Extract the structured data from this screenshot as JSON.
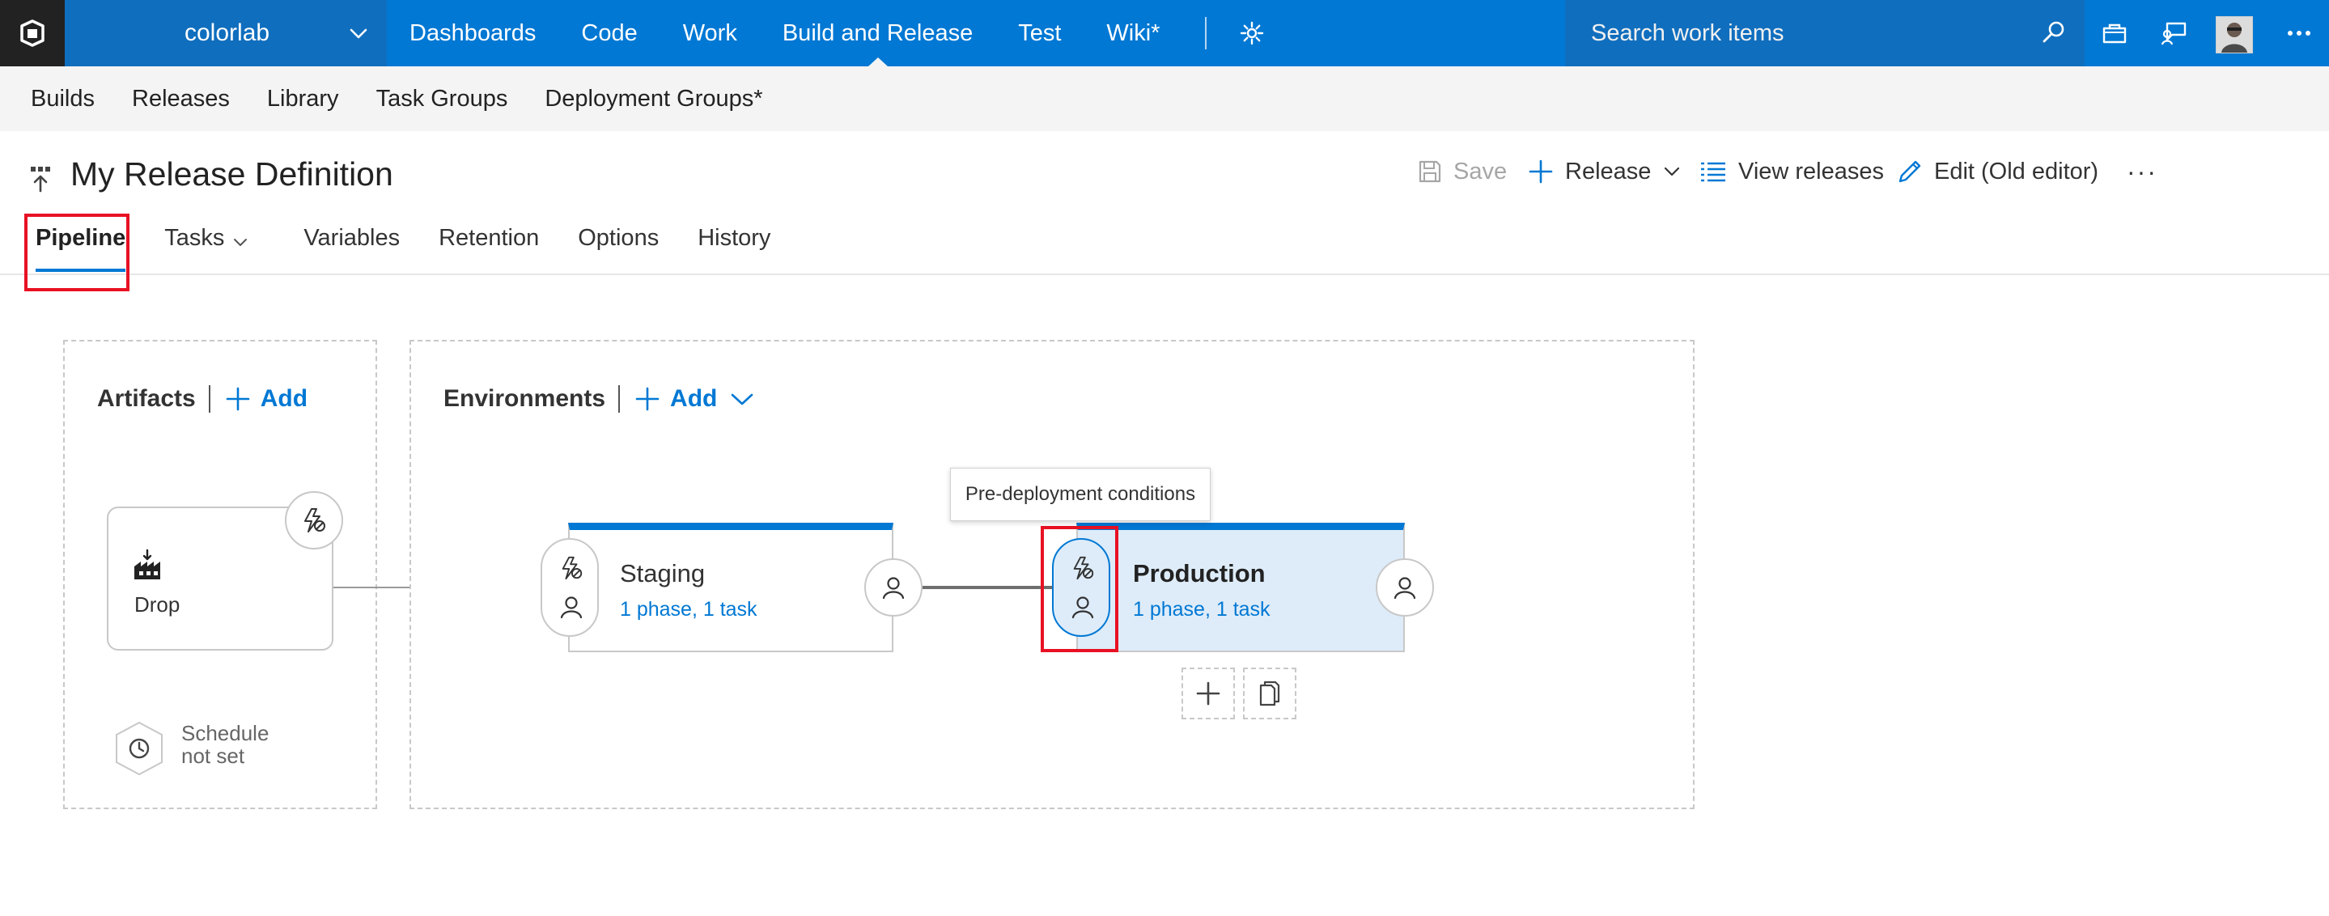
{
  "header": {
    "project": "colorlab",
    "nav": [
      "Dashboards",
      "Code",
      "Work",
      "Build and Release",
      "Test",
      "Wiki*"
    ],
    "active_nav": "Build and Release",
    "search_placeholder": "Search work items",
    "accent": "#0078d4"
  },
  "subnav": [
    "Builds",
    "Releases",
    "Library",
    "Task Groups",
    "Deployment Groups*"
  ],
  "page": {
    "title": "My Release Definition",
    "actions": {
      "save": "Save",
      "release": "Release",
      "view_releases": "View releases",
      "edit_old": "Edit (Old editor)",
      "more": "···"
    }
  },
  "tabs": [
    "Pipeline",
    "Tasks",
    "Variables",
    "Retention",
    "Options",
    "History"
  ],
  "active_tab": "Pipeline",
  "artifacts": {
    "title": "Artifacts",
    "add": "Add",
    "items": [
      {
        "name": "Drop",
        "icon": "build-factory-icon"
      }
    ],
    "schedule": "Schedule\nnot set"
  },
  "environments": {
    "title": "Environments",
    "add": "Add",
    "items": [
      {
        "name": "Staging",
        "summary": "1 phase, 1 task",
        "selected": false
      },
      {
        "name": "Production",
        "summary": "1 phase, 1 task",
        "selected": true
      }
    ],
    "tooltip": "Pre-deployment conditions"
  },
  "icons": [
    "logo-icon",
    "chevron-down-icon",
    "gear-icon",
    "search-icon",
    "bag-icon",
    "feedback-icon",
    "more-icon",
    "save-icon",
    "plus-icon",
    "list-icon",
    "pencil-icon",
    "lightning-trigger-icon",
    "person-icon",
    "clock-icon",
    "copy-icon"
  ],
  "highlight_color": "#e81123"
}
